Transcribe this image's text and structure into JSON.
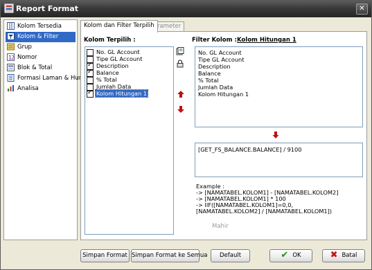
{
  "window": {
    "title": "Report Format",
    "close_label": "✕"
  },
  "nav": {
    "items": [
      {
        "label": "Kolom Tersedia",
        "icon": "columns-icon",
        "selected": false
      },
      {
        "label": "Kolom & Filter",
        "icon": "filter-icon",
        "selected": true
      },
      {
        "label": "Grup",
        "icon": "group-icon",
        "selected": false
      },
      {
        "label": "Nomor",
        "icon": "number-icon",
        "selected": false
      },
      {
        "label": "Blok & Total",
        "icon": "block-total-icon",
        "selected": false
      },
      {
        "label": "Formasi Laman & Huruf",
        "icon": "page-font-icon",
        "selected": false
      },
      {
        "label": "Analisa",
        "icon": "analysis-icon",
        "selected": false
      }
    ]
  },
  "tabs": [
    {
      "label": "Kolom dan Filter Terpilih",
      "active": true
    },
    {
      "label": "Parameter",
      "active": false
    }
  ],
  "columns": {
    "heading": "Kolom Terpilih :",
    "items": [
      {
        "label": "No. GL Account",
        "checked": false,
        "selected": false
      },
      {
        "label": "Tipe GL Account",
        "checked": false,
        "selected": false
      },
      {
        "label": "Description",
        "checked": true,
        "selected": false
      },
      {
        "label": "Balance",
        "checked": true,
        "selected": false
      },
      {
        "label": "% Total",
        "checked": false,
        "selected": false
      },
      {
        "label": "Jumlah Data",
        "checked": false,
        "selected": false
      },
      {
        "label": "Kolom Hitungan 1",
        "checked": true,
        "selected": true
      }
    ]
  },
  "filter": {
    "heading": "Filter Kolom :",
    "column_name": "Kolom Hitungan 1",
    "fields": [
      "No. GL Account",
      "Tipe GL Account",
      "Description",
      "Balance",
      "% Total",
      "Jumlah Data",
      "Kolom Hitungan 1"
    ],
    "formula": "[GET_FS_BALANCE.BALANCE] / 9100"
  },
  "example": {
    "heading": "Example :",
    "lines": [
      "->  [NAMATABEL.KOLOM1] - [NAMATABEL.KOLOM2]",
      "->  [NAMATABEL.KOLOM1] * 100",
      "->  IIF([NAMATABEL.KOLOM1]=0,0,",
      "      [NAMATABEL.KOLOM2] / [NAMATABEL.KOLOM1])"
    ]
  },
  "mahir_label": "Mahir",
  "buttons": {
    "save_format": "Simpan Format",
    "save_format_all": "Simpan Format ke Semua",
    "default": "Default",
    "ok": "OK",
    "cancel": "Batal"
  },
  "colors": {
    "selection": "#3169c6",
    "ok_green": "#1e8f1e",
    "cancel_red": "#c81414",
    "arrow_red": "#c01010"
  }
}
